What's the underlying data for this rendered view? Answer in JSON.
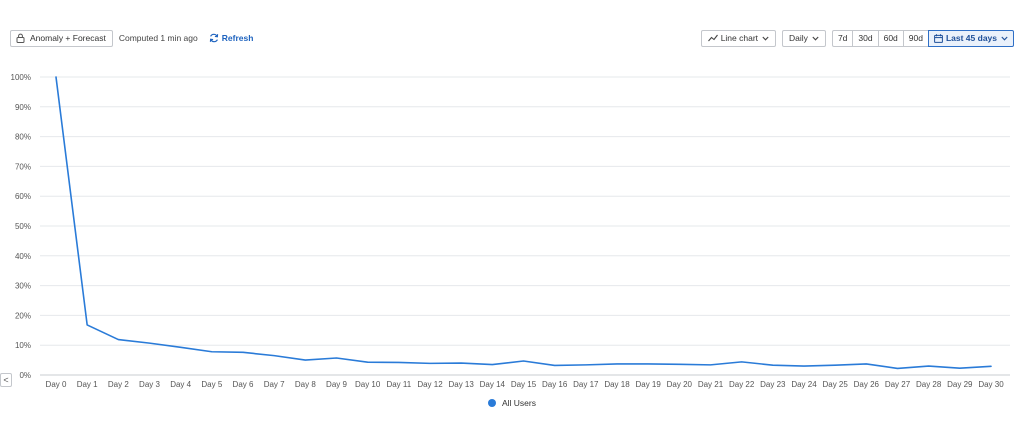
{
  "toolbar": {
    "anomaly_label": "Anomaly + Forecast",
    "computed_label": "Computed 1 min ago",
    "refresh_label": "Refresh",
    "chart_type_label": "Line chart",
    "interval_label": "Daily",
    "ranges": [
      "7d",
      "30d",
      "60d",
      "90d"
    ],
    "active_range_label": "Last 45 days"
  },
  "nav": {
    "prev_label": "<"
  },
  "colors": {
    "series": "#2a7bd8",
    "accent": "#1e63bf",
    "grid": "#e6e8eb",
    "axis": "#c9ccd1"
  },
  "chart_data": {
    "type": "line",
    "categories": [
      "Day 0",
      "Day 1",
      "Day 2",
      "Day 3",
      "Day 4",
      "Day 5",
      "Day 6",
      "Day 7",
      "Day 8",
      "Day 9",
      "Day 10",
      "Day 11",
      "Day 12",
      "Day 13",
      "Day 14",
      "Day 15",
      "Day 16",
      "Day 17",
      "Day 18",
      "Day 19",
      "Day 20",
      "Day 21",
      "Day 22",
      "Day 23",
      "Day 24",
      "Day 25",
      "Day 26",
      "Day 27",
      "Day 28",
      "Day 29",
      "Day 30"
    ],
    "y_ticks": [
      "0%",
      "10%",
      "20%",
      "30%",
      "40%",
      "50%",
      "60%",
      "70%",
      "80%",
      "90%",
      "100%"
    ],
    "ylim": [
      0,
      100
    ],
    "grid": true,
    "legend_position": "bottom-center",
    "series": [
      {
        "name": "All Users",
        "values": [
          100,
          16.8,
          11.9,
          10.7,
          9.3,
          7.8,
          7.6,
          6.5,
          5.0,
          5.7,
          4.3,
          4.2,
          3.9,
          4.0,
          3.5,
          4.7,
          3.2,
          3.4,
          3.7,
          3.7,
          3.6,
          3.4,
          4.4,
          3.3,
          3.0,
          3.3,
          3.7,
          2.2,
          3.0,
          2.3,
          2.9
        ]
      }
    ]
  }
}
